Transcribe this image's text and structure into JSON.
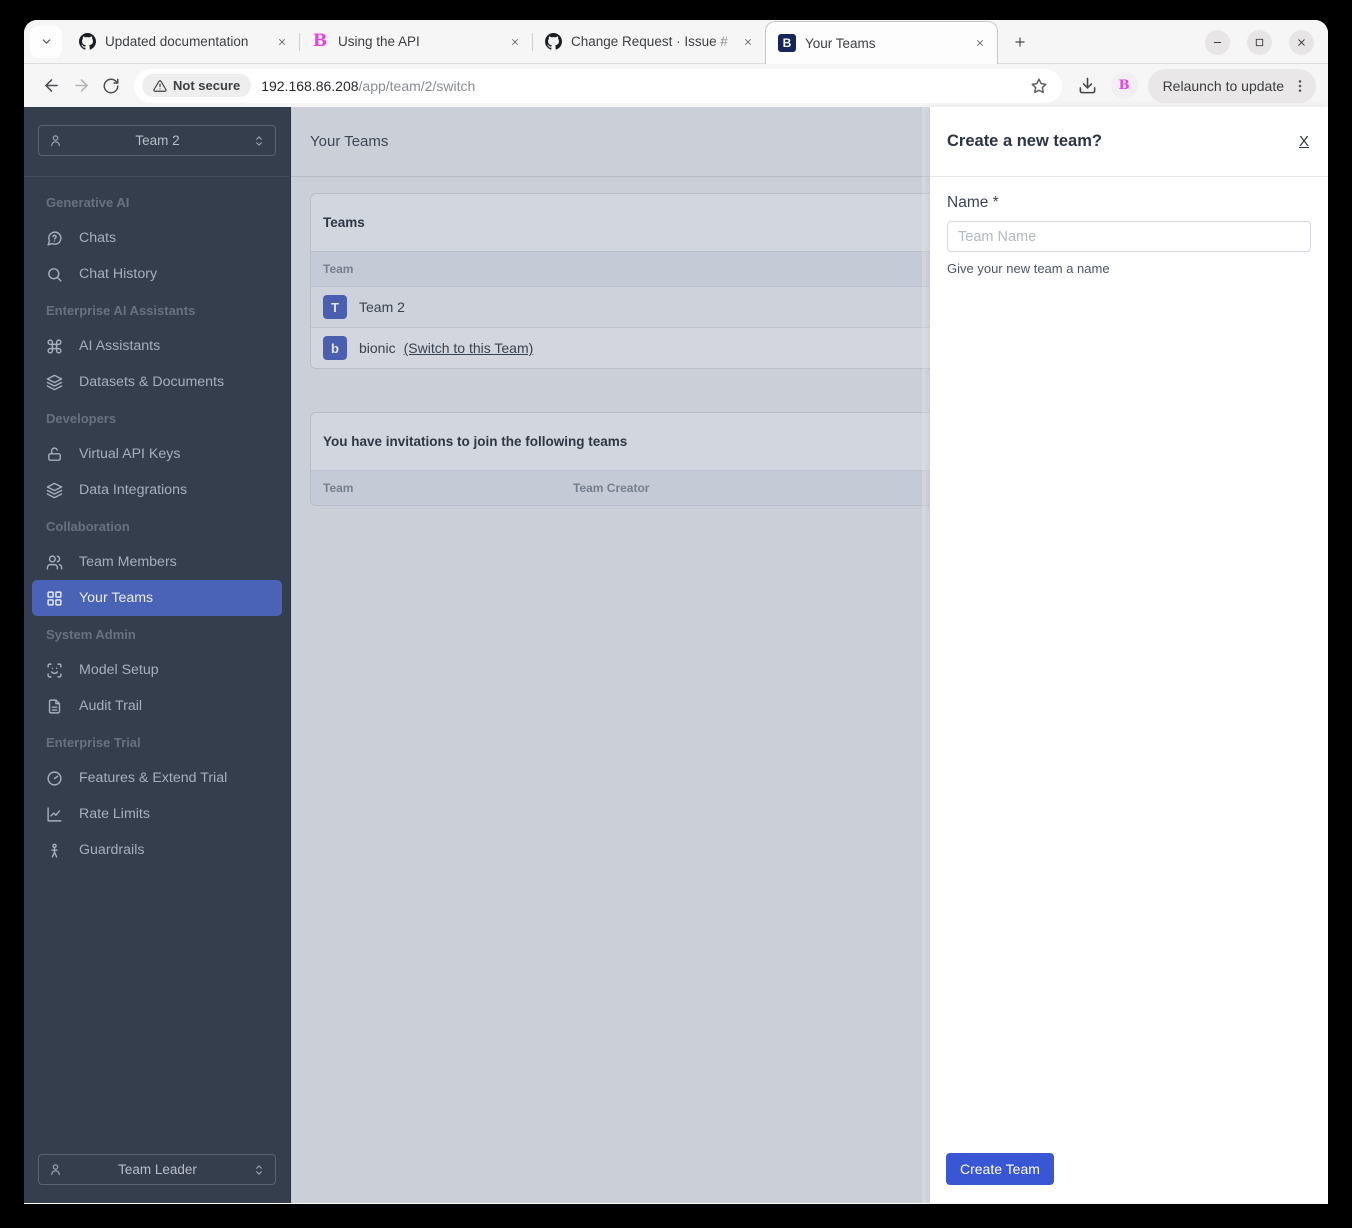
{
  "browser": {
    "tabs": [
      {
        "title": "Updated documentation",
        "favicon": "github",
        "favicon_letter": ""
      },
      {
        "title": "Using the API",
        "favicon": "letter-pink",
        "favicon_letter": "B"
      },
      {
        "title": "Change Request · Issue #",
        "favicon": "github",
        "favicon_letter": ""
      },
      {
        "title": "Your Teams",
        "favicon": "letter-navy",
        "favicon_letter": "B",
        "active": true
      }
    ],
    "address": {
      "security_label": "Not secure",
      "host": "192.168.86.208",
      "path": "/app/team/2/switch"
    },
    "relaunch_label": "Relaunch to update"
  },
  "sidebar": {
    "team_selector_value": "Team 2",
    "role_selector_value": "Team Leader",
    "sections": [
      {
        "label": "Generative AI",
        "items": [
          {
            "label": "Chats",
            "icon": "chat-question"
          },
          {
            "label": "Chat History",
            "icon": "search"
          }
        ]
      },
      {
        "label": "Enterprise AI Assistants",
        "items": [
          {
            "label": "AI Assistants",
            "icon": "command"
          },
          {
            "label": "Datasets & Documents",
            "icon": "layers"
          }
        ]
      },
      {
        "label": "Developers",
        "items": [
          {
            "label": "Virtual API Keys",
            "icon": "unlock"
          },
          {
            "label": "Data Integrations",
            "icon": "layers"
          }
        ]
      },
      {
        "label": "Collaboration",
        "items": [
          {
            "label": "Team Members",
            "icon": "users"
          },
          {
            "label": "Your Teams",
            "icon": "grid",
            "active": true
          }
        ]
      },
      {
        "label": "System Admin",
        "items": [
          {
            "label": "Model Setup",
            "icon": "scan-face"
          },
          {
            "label": "Audit Trail",
            "icon": "file-text"
          }
        ]
      },
      {
        "label": "Enterprise Trial",
        "items": [
          {
            "label": "Features & Extend Trial",
            "icon": "gauge"
          },
          {
            "label": "Rate Limits",
            "icon": "line-chart"
          },
          {
            "label": "Guardrails",
            "icon": "person"
          }
        ]
      }
    ]
  },
  "main": {
    "page_title": "Your Teams",
    "teams_card": {
      "title": "Teams",
      "columns": [
        "Team"
      ],
      "rows": [
        {
          "initial": "T",
          "name": "Team 2",
          "link": ""
        },
        {
          "initial": "b",
          "name": "bionic",
          "link": "(Switch to this Team)"
        }
      ]
    },
    "invitations_card": {
      "title": "You have invitations to join the following teams",
      "columns": [
        "Team",
        "Team Creator"
      ]
    }
  },
  "panel": {
    "title": "Create a new team?",
    "close_label": "X",
    "name_label": "Name *",
    "name_placeholder": "Team Name",
    "name_hint": "Give your new team a name",
    "submit_label": "Create Team"
  },
  "colors": {
    "accent_blue": "#3957d5",
    "sidebar_selected_blue": "#4a63b6",
    "avatar_blue": "#4a5fb0",
    "favicon_navy": "#16265a",
    "bionic_pink": "#e83ee8",
    "sidebar_bg": "#343e4d",
    "content_bg": "#cacfd8"
  }
}
